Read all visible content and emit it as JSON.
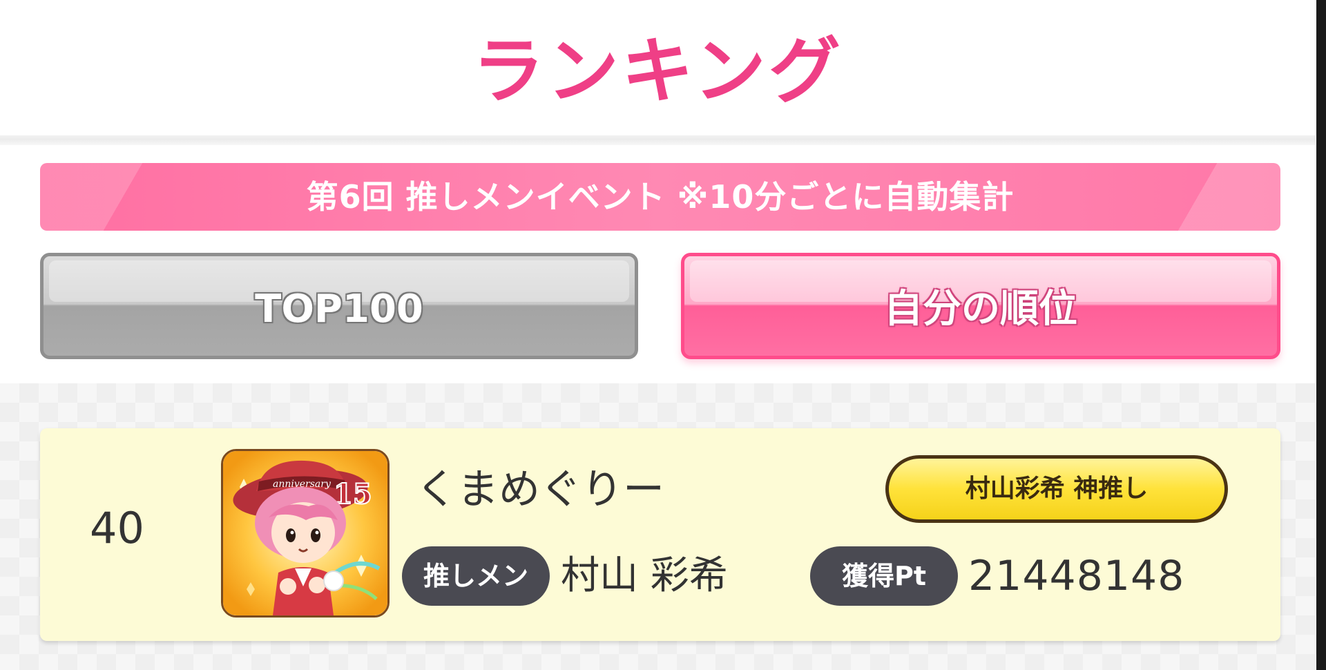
{
  "header": {
    "title": "ランキング"
  },
  "event": {
    "banner_text": "第6回 推しメンイベント ※10分ごとに自動集計"
  },
  "tabs": [
    {
      "label": "TOP100",
      "active": false
    },
    {
      "label": "自分の順位",
      "active": true
    }
  ],
  "ranking_entry": {
    "rank": "40",
    "player_name": "くまめぐりー",
    "badge": "村山彩希 神推し",
    "oshimen_label": "推しメン",
    "oshimen_value": "村山 彩希",
    "points_label": "獲得Pt",
    "points_value": "21448148",
    "avatar_icon": "anniversary-15-avatar-icon"
  },
  "colors": {
    "title_pink": "#ef3f86",
    "banner_pink": "#ff7aa8",
    "active_tab_pink": "#ff5f98",
    "inactive_tab_gray": "#a4a4a4",
    "card_yellow": "#fdfbd6",
    "badge_yellow": "#ffe23a",
    "pill_dark": "#4a4a52"
  }
}
